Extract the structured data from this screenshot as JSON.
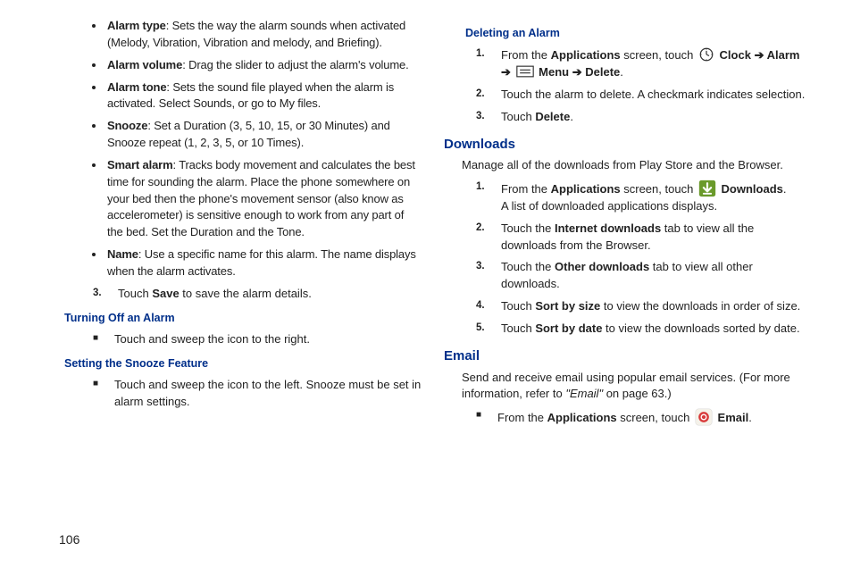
{
  "col1": {
    "bullets": [
      {
        "term": "Alarm type",
        "desc": ": Sets the way the alarm sounds when activated (Melody, Vibration, Vibration and melody, and Briefing)."
      },
      {
        "term": "Alarm volume",
        "desc": ": Drag the slider to adjust the alarm's volume."
      },
      {
        "term": "Alarm tone",
        "desc": ": Sets the sound file played when the alarm is activated. Select Sounds, or go to My files."
      },
      {
        "term": "Snooze",
        "desc": ": Set a Duration (3, 5, 10, 15, or 30 Minutes) and Snooze repeat (1, 2, 3, 5, or 10 Times)."
      },
      {
        "term": "Smart alarm",
        "desc": ": Tracks body movement and calculates the best time for sounding the alarm. Place the phone somewhere on your bed then the phone's movement sensor (also know as accelerometer) is sensitive enough to work from any part of the bed. Set the Duration and the Tone."
      },
      {
        "term": "Name",
        "desc": ": Use a specific name for this alarm. The name displays when the alarm activates."
      }
    ],
    "step3_pre": "Touch ",
    "step3_b": "Save",
    "step3_post": " to save the alarm details.",
    "hTurnOff": "Turning Off an Alarm",
    "sqTurnOff": "Touch and sweep the icon to the right.",
    "hSnooze": "Setting the Snooze Feature",
    "sqSnooze": "Touch and sweep the icon to the left. Snooze must be set in alarm settings."
  },
  "col2": {
    "hDel": "Deleting an Alarm",
    "del1_a": "From the ",
    "del1_apps": "Applications",
    "del1_b": " screen, touch ",
    "del1_clock": " Clock ",
    "del1_arrow1": "➔",
    "del1_alarm": " Alarm ",
    "del1_arrow2": "➔",
    "del1_menu": " Menu ",
    "del1_arrow3": "➔",
    "del1_delete": " Delete",
    "del1_period": ".",
    "del2": "Touch the alarm to delete. A checkmark indicates selection.",
    "del3_pre": "Touch ",
    "del3_b": "Delete",
    "del3_post": ".",
    "hDown": "Downloads",
    "downIntro": "Manage all of the downloads from Play Store and the Browser.",
    "dn1_a": "From the ",
    "dn1_apps": "Applications",
    "dn1_b": " screen, touch ",
    "dn1_label": " Downloads",
    "dn1_period": ".",
    "dn1_line2": "A list of downloaded applications displays.",
    "dn2_a": "Touch the ",
    "dn2_b": "Internet downloads",
    "dn2_c": " tab to view all the downloads from the Browser.",
    "dn3_a": "Touch the ",
    "dn3_b": "Other downloads",
    "dn3_c": " tab to view all other downloads.",
    "dn4_a": "Touch ",
    "dn4_b": "Sort by size",
    "dn4_c": " to view the downloads in order of size.",
    "dn5_a": "Touch ",
    "dn5_b": "Sort by date",
    "dn5_c": " to view the downloads sorted by date.",
    "hEmail": "Email",
    "emailIntro_a": "Send and receive email using popular email services. (For more information, refer to ",
    "emailIntro_ref": "\"Email\"",
    "emailIntro_b": "  on page 63.)",
    "em_sq_a": "From the ",
    "em_sq_apps": "Applications",
    "em_sq_b": " screen, touch ",
    "em_sq_label": " Email",
    "em_sq_period": "."
  },
  "pageNumber": "106"
}
